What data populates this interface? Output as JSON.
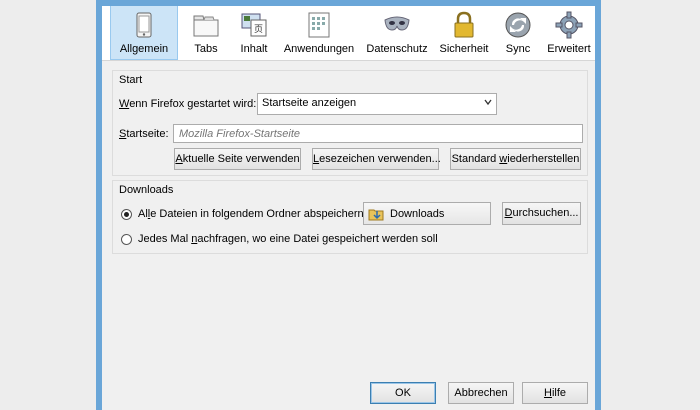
{
  "toolbar": {
    "items": [
      {
        "label": "Allgemein",
        "icon": "general-icon",
        "selected": true
      },
      {
        "label": "Tabs",
        "icon": "tabs-icon"
      },
      {
        "label": "Inhalt",
        "icon": "content-icon"
      },
      {
        "label": "Anwendungen",
        "icon": "applications-icon"
      },
      {
        "label": "Datenschutz",
        "icon": "privacy-mask-icon"
      },
      {
        "label": "Sicherheit",
        "icon": "security-lock-icon"
      },
      {
        "label": "Sync",
        "icon": "sync-icon"
      },
      {
        "label": "Erweitert",
        "icon": "advanced-gear-icon"
      }
    ]
  },
  "start": {
    "title": "Start",
    "startup_label_pre": "",
    "startup_label_key": "W",
    "startup_label_post": "enn Firefox gestartet wird:",
    "startup_value": "Startseite anzeigen",
    "homepage_label_key": "S",
    "homepage_label_post": "tartseite:",
    "homepage_value": "",
    "homepage_placeholder": "Mozilla Firefox-Startseite",
    "btn_current_key": "A",
    "btn_current_post": "ktuelle Seite verwenden",
    "btn_bookmark_key": "L",
    "btn_bookmark_post": "esezeichen verwenden...",
    "btn_default_pre": "Standard ",
    "btn_default_key": "w",
    "btn_default_post": "iederherstellen"
  },
  "downloads": {
    "title": "Downloads",
    "save_pre": "Al",
    "save_key": "l",
    "save_post": "e Dateien in folgendem Ordner abspeichern:",
    "folder": "Downloads",
    "browse_key": "D",
    "browse_post": "urchsuchen...",
    "ask_pre": "Jedes Mal ",
    "ask_key": "n",
    "ask_post": "achfragen, wo eine Datei gespeichert werden soll"
  },
  "footer": {
    "ok": "OK",
    "cancel": "Abbrechen",
    "help_key": "H",
    "help_post": "ilfe"
  }
}
